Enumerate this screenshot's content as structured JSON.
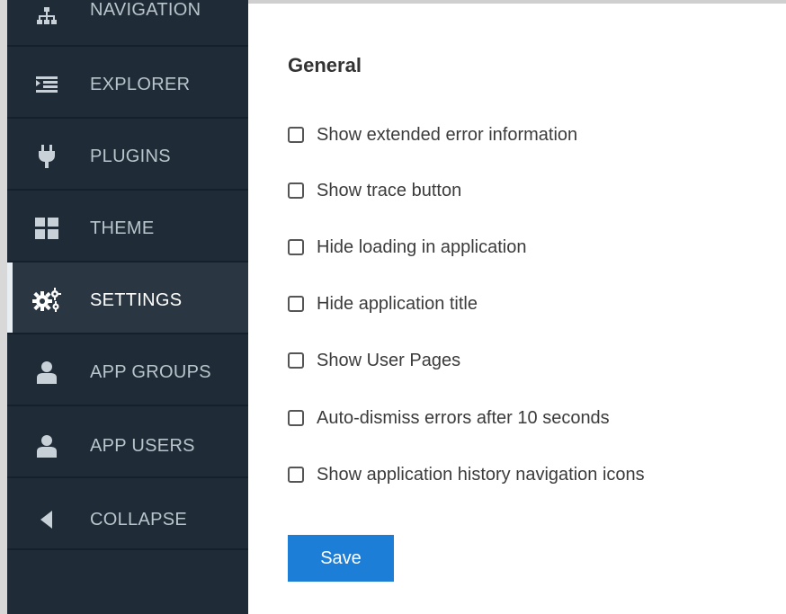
{
  "sidebar": {
    "items": [
      {
        "label": "NAVIGATION",
        "icon": "sitemap-icon"
      },
      {
        "label": "EXPLORER",
        "icon": "indent-list-icon"
      },
      {
        "label": "PLUGINS",
        "icon": "plug-icon"
      },
      {
        "label": "THEME",
        "icon": "grid-icon"
      },
      {
        "label": "SETTINGS",
        "icon": "gears-icon",
        "active": true
      },
      {
        "label": "APP GROUPS",
        "icon": "user-icon"
      },
      {
        "label": "APP USERS",
        "icon": "user-icon"
      },
      {
        "label": "COLLAPSE",
        "icon": "triangle-left-icon"
      }
    ]
  },
  "settings": {
    "title": "General",
    "options": [
      {
        "label": "Show extended error information",
        "checked": false
      },
      {
        "label": "Show trace button",
        "checked": false
      },
      {
        "label": "Hide loading in application",
        "checked": false
      },
      {
        "label": "Hide application title",
        "checked": false
      },
      {
        "label": "Show User Pages",
        "checked": false
      },
      {
        "label": "Auto-dismiss errors after 10 seconds",
        "checked": false
      },
      {
        "label": "Show application history navigation icons",
        "checked": false
      }
    ],
    "save_label": "Save"
  },
  "colors": {
    "sidebar_bg": "#1f2b36",
    "sidebar_active_bg": "#2a3742",
    "accent": "#1d7ed8"
  }
}
